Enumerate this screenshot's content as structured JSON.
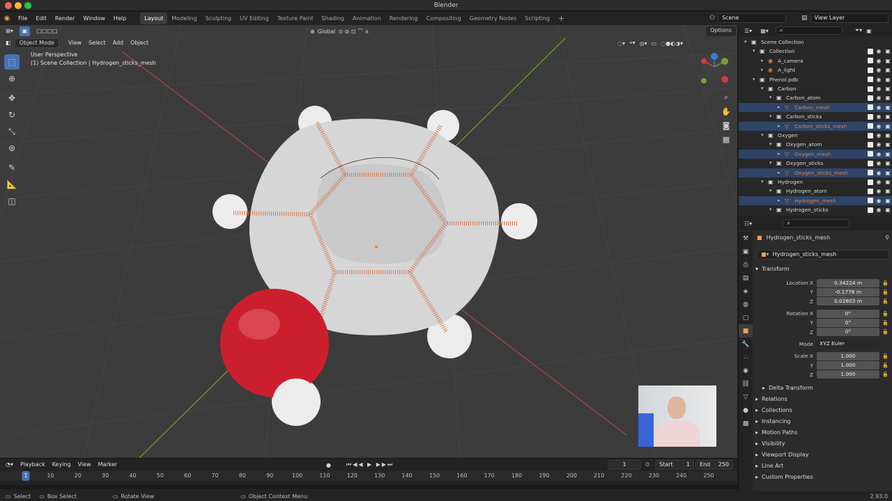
{
  "window": {
    "title": "Blender"
  },
  "menu": {
    "items": [
      "File",
      "Edit",
      "Render",
      "Window",
      "Help"
    ],
    "workspaces": [
      "Layout",
      "Modeling",
      "Sculpting",
      "UV Editing",
      "Texture Paint",
      "Shading",
      "Animation",
      "Rendering",
      "Compositing",
      "Geometry Nodes",
      "Scripting"
    ],
    "active_workspace": "Layout",
    "scene": "Scene",
    "view_layer": "View Layer"
  },
  "viewport": {
    "mode": "Object Mode",
    "menus": [
      "View",
      "Select",
      "Add",
      "Object"
    ],
    "orientation": "Global",
    "options": "Options",
    "info_line1": "User Perspective",
    "info_line2": "(1) Scene Collection | Hydrogen_sticks_mesh"
  },
  "timeline": {
    "menus": [
      "Playback",
      "Keying",
      "View",
      "Marker"
    ],
    "current_frame": "1",
    "start_label": "Start",
    "start": "1",
    "end_label": "End",
    "end": "250",
    "ticks": [
      "1",
      "10",
      "20",
      "30",
      "40",
      "50",
      "60",
      "70",
      "80",
      "90",
      "100",
      "110",
      "120",
      "130",
      "140",
      "150",
      "160",
      "170",
      "180",
      "190",
      "200",
      "210",
      "220",
      "230",
      "240",
      "250"
    ]
  },
  "statusbar": {
    "select": "Select",
    "box_select": "Box Select",
    "rotate": "Rotate View",
    "context": "Object Context Menu",
    "version": "2.93.0"
  },
  "outliner": {
    "rows": [
      {
        "label": "Scene Collection",
        "indent": 0,
        "type": "scene",
        "state": ""
      },
      {
        "label": "Collection",
        "indent": 1,
        "type": "coll",
        "state": ""
      },
      {
        "label": "A_camera",
        "indent": 2,
        "type": "obj",
        "state": ""
      },
      {
        "label": "A_light",
        "indent": 2,
        "type": "obj",
        "state": ""
      },
      {
        "label": "Phenol.pdb",
        "indent": 1,
        "type": "coll",
        "state": ""
      },
      {
        "label": "Carbon",
        "indent": 2,
        "type": "coll",
        "state": ""
      },
      {
        "label": "Carbon_atom",
        "indent": 3,
        "type": "coll",
        "state": ""
      },
      {
        "label": "Carbon_mesh",
        "indent": 4,
        "type": "mesh",
        "state": "sel"
      },
      {
        "label": "Carbon_sticks",
        "indent": 3,
        "type": "coll",
        "state": ""
      },
      {
        "label": "Carbon_sticks_mesh",
        "indent": 4,
        "type": "mesh",
        "state": "sel"
      },
      {
        "label": "Oxygen",
        "indent": 2,
        "type": "coll",
        "state": ""
      },
      {
        "label": "Oxygen_atom",
        "indent": 3,
        "type": "coll",
        "state": ""
      },
      {
        "label": "Oxygen_mesh",
        "indent": 4,
        "type": "mesh",
        "state": "sel"
      },
      {
        "label": "Oxygen_sticks",
        "indent": 3,
        "type": "coll",
        "state": ""
      },
      {
        "label": "Oxygen_sticks_mesh",
        "indent": 4,
        "type": "mesh",
        "state": "sel"
      },
      {
        "label": "Hydrogen",
        "indent": 2,
        "type": "coll",
        "state": ""
      },
      {
        "label": "Hydrogen_atom",
        "indent": 3,
        "type": "coll",
        "state": ""
      },
      {
        "label": "Hydrogen_mesh",
        "indent": 4,
        "type": "mesh",
        "state": "sel"
      },
      {
        "label": "Hydrogen_sticks",
        "indent": 3,
        "type": "coll",
        "state": ""
      }
    ]
  },
  "properties": {
    "object_name": "Hydrogen_sticks_mesh",
    "data_name": "Hydrogen_sticks_mesh",
    "transform_title": "Transform",
    "location_label": "Location X",
    "location": {
      "x": "0.34224 m",
      "y": "-0.1778 m",
      "z": "0.02803 m"
    },
    "rotation_label": "Rotation X",
    "rotation": {
      "x": "0°",
      "y": "0°",
      "z": "0°"
    },
    "mode_label": "Mode",
    "mode": "XYZ Euler",
    "scale_label": "Scale X",
    "scale": {
      "x": "1.000",
      "y": "1.000",
      "z": "1.000"
    },
    "y_label": "Y",
    "z_label": "Z",
    "delta_transform": "Delta Transform",
    "panels": [
      "Relations",
      "Collections",
      "Instancing",
      "Motion Paths",
      "Visibility",
      "Viewport Display",
      "Line Art",
      "Custom Properties"
    ]
  },
  "colors": {
    "accent": "#4772b3",
    "selection": "#2f4467",
    "object_orange": "#e0814b",
    "oxygen_red": "#cc1f2d"
  }
}
